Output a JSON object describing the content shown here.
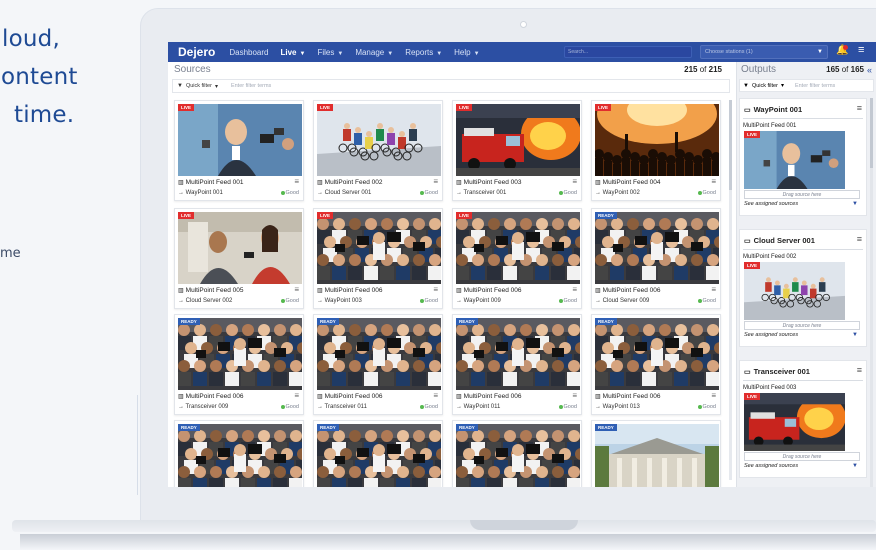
{
  "hero": {
    "line1": "loud,",
    "line2": "ontent",
    "line3": "time.",
    "small": "me"
  },
  "nav": {
    "brand": "Dejero",
    "items": [
      {
        "label": "Dashboard",
        "caret": false,
        "active": false
      },
      {
        "label": "Live",
        "caret": true,
        "active": true
      },
      {
        "label": "Files",
        "caret": true,
        "active": false
      },
      {
        "label": "Manage",
        "caret": true,
        "active": false
      },
      {
        "label": "Reports",
        "caret": true,
        "active": false
      },
      {
        "label": "Help",
        "caret": true,
        "active": false
      }
    ],
    "search_placeholder": "Search...",
    "stations_placeholder": "Choose stations (1)"
  },
  "sources": {
    "title": "Sources",
    "count_shown": "215",
    "count_of": "of",
    "count_total": "215",
    "quick_filter": "Quick filter",
    "filter_placeholder": "Enter filter terms",
    "cards": [
      {
        "title": "MultiPoint Feed 001",
        "dest": "→ WayPoint 001",
        "status": "Good",
        "badge": "LIVE",
        "scene": "reporter"
      },
      {
        "title": "MultiPoint Feed 002",
        "dest": "→ Cloud Server 001",
        "status": "Good",
        "badge": "LIVE",
        "scene": "cyclists"
      },
      {
        "title": "MultiPoint Feed 003",
        "dest": "→ Transceiver 001",
        "status": "Good",
        "badge": "LIVE",
        "scene": "firetruck"
      },
      {
        "title": "MultiPoint Feed 004",
        "dest": "→ WayPoint 002",
        "status": "Good",
        "badge": "LIVE",
        "scene": "concert"
      },
      {
        "title": "MultiPoint Feed 005",
        "dest": "→ Cloud Server 002",
        "status": "Good",
        "badge": "LIVE",
        "scene": "interview"
      },
      {
        "title": "MultiPoint Feed 006",
        "dest": "→ WayPoint 003",
        "status": "Good",
        "badge": "LIVE",
        "scene": "press"
      },
      {
        "title": "MultiPoint Feed 006",
        "dest": "→ WayPoint 009",
        "status": "Good",
        "badge": "LIVE",
        "scene": "press"
      },
      {
        "title": "MultiPoint Feed 006",
        "dest": "→ Cloud Server 009",
        "status": "Good",
        "badge": "READY",
        "scene": "press"
      },
      {
        "title": "MultiPoint Feed 006",
        "dest": "→ Transceiver 009",
        "status": "Good",
        "badge": "READY",
        "scene": "press"
      },
      {
        "title": "MultiPoint Feed 006",
        "dest": "→ Transceiver 011",
        "status": "Good",
        "badge": "READY",
        "scene": "press"
      },
      {
        "title": "MultiPoint Feed 006",
        "dest": "→ WayPoint 011",
        "status": "Good",
        "badge": "READY",
        "scene": "press"
      },
      {
        "title": "MultiPoint Feed 006",
        "dest": "→ WayPoint 013",
        "status": "Good",
        "badge": "READY",
        "scene": "press"
      },
      {
        "title": "",
        "dest": "",
        "status": "",
        "badge": "READY",
        "scene": "press"
      },
      {
        "title": "",
        "dest": "",
        "status": "",
        "badge": "READY",
        "scene": "press"
      },
      {
        "title": "",
        "dest": "",
        "status": "",
        "badge": "READY",
        "scene": "press"
      },
      {
        "title": "",
        "dest": "",
        "status": "",
        "badge": "READY",
        "scene": "building"
      }
    ]
  },
  "outputs": {
    "title": "Outputs",
    "count_shown": "165",
    "count_of": "of",
    "count_total": "165",
    "quick_filter": "Quick filter",
    "filter_placeholder": "Enter filter terms",
    "cards": [
      {
        "name": "WayPoint 001",
        "icon": "waypoint-device-icon",
        "feed": "MultiPoint Feed 001",
        "badge": "LIVE",
        "scene": "reporter",
        "drag": "Drag source here",
        "see": "See assigned sources"
      },
      {
        "name": "Cloud Server 001",
        "icon": "cloud-server-icon",
        "feed": "MultiPoint Feed 002",
        "badge": "LIVE",
        "scene": "cyclists",
        "drag": "Drag source here",
        "see": "See assigned sources"
      },
      {
        "name": "Transceiver 001",
        "icon": "transceiver-icon",
        "feed": "MultiPoint Feed 003",
        "badge": "LIVE",
        "scene": "firetruck",
        "drag": "Drag source here",
        "see": "See assigned sources"
      }
    ]
  },
  "colors": {
    "nav": "#2c4fa3",
    "live": "#e12d2d",
    "ready": "#2f5fb4",
    "good": "#56b94f",
    "hero_text": "#1e4a94"
  }
}
